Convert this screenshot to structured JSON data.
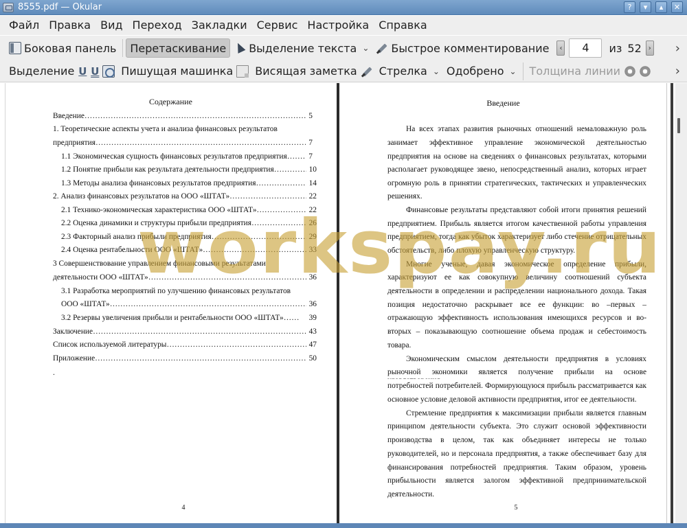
{
  "window": {
    "title": "8555.pdf — Okular",
    "buttons": [
      "?",
      "▾",
      "▴",
      "✕"
    ]
  },
  "menu": [
    "Файл",
    "Правка",
    "Вид",
    "Переход",
    "Закладки",
    "Сервис",
    "Настройка",
    "Справка"
  ],
  "toolbar1": {
    "sidebar": "Боковая панель",
    "browse": "Перетаскивание",
    "text_select": "Выделение текста",
    "quick_annot": "Быстрое комментирование",
    "page_current": "4",
    "page_of": "из",
    "page_total": "52"
  },
  "toolbar2": {
    "selection": "Выделение",
    "typewriter": "Пишущая машинка",
    "inline_note": "Висящая заметка",
    "arrow": "Стрелка",
    "approved": "Одобрено",
    "line_width": "Толщина линии"
  },
  "left_page": {
    "title": "Содержание",
    "toc": [
      {
        "title": "Введение",
        "page": "5"
      },
      {
        "title": "1. Теоретические аспекты учета и анализа финансовых результатов",
        "page": ""
      },
      {
        "title": "предприятия",
        "page": "7"
      },
      {
        "title": "1.1 Экономическая сущность финансовых результатов предприятия",
        "page": "7"
      },
      {
        "title": "1.2 Понятие прибыли как результата деятельности предприятия",
        "page": "10"
      },
      {
        "title": "1.3 Методы анализа финансовых результатов предприятия",
        "page": "14"
      },
      {
        "title": "2. Анализ финансовых результатов на ООО «ШТАТ»",
        "page": "22"
      },
      {
        "title": "2.1 Технико-экономическая характеристика ООО «ШТАТ»",
        "page": "22"
      },
      {
        "title": "2.2 Оценка динамики и структуры прибыли предприятия",
        "page": "26"
      },
      {
        "title": "2.3  Факторный анализ прибыли предприятия",
        "page": "29"
      },
      {
        "title": "2.4 Оценка рентабельности ООО «ШТАТ»",
        "page": "33"
      },
      {
        "title": "3 Совершенствование управлением финансовыми результатами",
        "page": ""
      },
      {
        "title": "деятельности  ООО «ШТАТ»",
        "page": "36"
      },
      {
        "title": "3.1  Разработка мероприятий по улучшению финансовых результатов",
        "page": ""
      },
      {
        "title": "ООО «ШТАТ»",
        "page": "36"
      },
      {
        "title": "3.2 Резервы увеличения прибыли и рентабельности ООО «ШТАТ»",
        "page": "39"
      },
      {
        "title": "Заключение",
        "page": "43"
      },
      {
        "title": "Список используемой литературы",
        "page": "47"
      },
      {
        "title": "Приложение",
        "page": "50"
      }
    ],
    "trailing_dot": ".",
    "page_number": "4"
  },
  "right_page": {
    "title": "Введение",
    "lines": [
      "На всех этапах развития рыночных отношений немаловажную роль",
      "занимает эффективное управление экономической деятельностью",
      "предприятия на основе на сведениях о финансовых результатах, которыми",
      "располагает руководящее звено, непосредственный анализ, которых играет",
      "огромную роль в принятии стратегических, тактических и управленческих",
      "решениях.",
      "Финансовые результаты представляют собой итоги принятия решений",
      "предприятием. Прибыль является итогом качественной работы управления",
      "предприятием, тогда как убыток характеризует либо стечение отрицательных",
      "обстоятельств, либо плохую управленческую структуру.",
      "Многие ученые, давая экономическое определение прибыли,",
      "характеризуют ее как совокупную величину соотношений субъекта",
      "деятельности в определении и распределении национального дохода. Такая",
      "позиция недостаточно раскрывает все ее функции: во –первых –",
      "отражающую эффективность использования имеющихся ресурсов и во-",
      "вторых – показывающую соотношение объема продаж и себестоимость",
      "товара.",
      "Экономическим смыслом деятельности предприятия в условиях",
      "рыночной экономики является получение прибыли на основе удовлетворения",
      "потребностей потребителей. Формирующуюся прибыль рассматривается как",
      "основное условие деловой активности предприятия, итог ее деятельности.",
      "Стремление предприятия к максимизации прибыли является главным",
      "принципом деятельности субъекта.  Это служит основой эффективности",
      "производства в целом, так как объединяет интересы не только",
      "руководителей, но и персонала предприятия, а также обеспечивает базу для",
      "финансирования потребностей предприятия. Таким образом, уровень",
      "прибыльности является залогом эффективной предпринимательской",
      "деятельности."
    ],
    "page_number": "5"
  },
  "watermark": "workspay.ru",
  "colors": {
    "titlebar": "#6a93c2",
    "toolbar": "#eeeeee",
    "watermark": "#c9a238"
  }
}
